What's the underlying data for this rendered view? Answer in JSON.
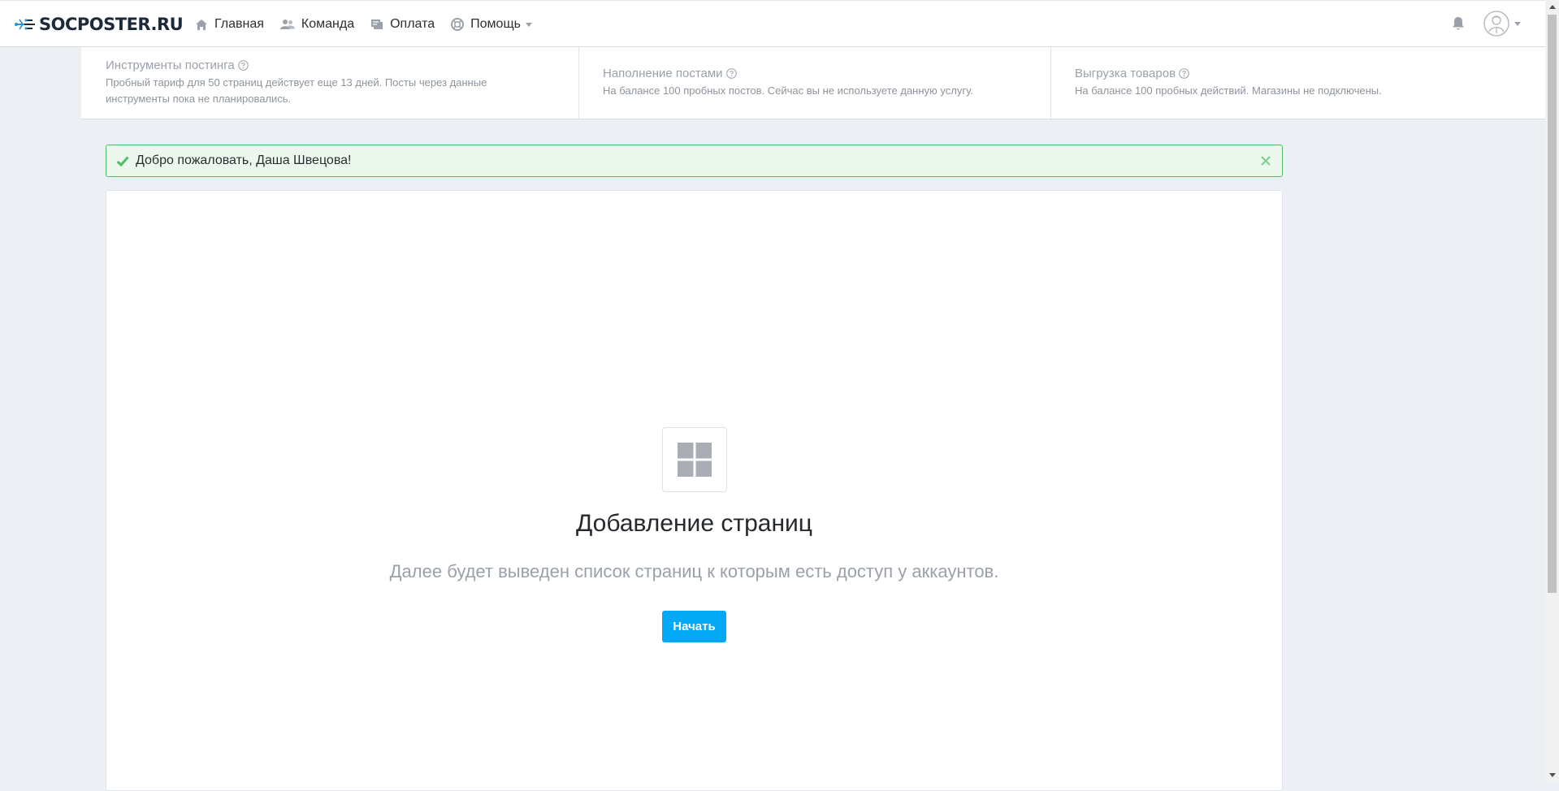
{
  "brand": {
    "name": "SOCPOSTER.RU"
  },
  "nav": {
    "items": [
      {
        "label": "Главная",
        "icon": "home-icon"
      },
      {
        "label": "Команда",
        "icon": "team-icon"
      },
      {
        "label": "Оплата",
        "icon": "payment-icon"
      },
      {
        "label": "Помощь",
        "icon": "help-lifebuoy-icon"
      }
    ]
  },
  "header_right": {
    "bell_icon": "bell-icon",
    "avatar_icon": "user-avatar-icon"
  },
  "info": {
    "posting": {
      "title": "Инструменты постинга",
      "text_line1": "Пробный тариф для 50 страниц действует еще 13 дней. Посты через данные",
      "text_line2": "инструменты пока не планировались."
    },
    "filling": {
      "title": "Наполнение постами",
      "text": "На балансе 100 пробных постов. Сейчас вы не используете данную услугу."
    },
    "export": {
      "title": "Выгрузка товаров",
      "text": "На балансе 100 пробных действий. Магазины не подключены."
    }
  },
  "alert": {
    "text": "Добро пожаловать, Даша Швецова!"
  },
  "card": {
    "title": "Добавление страниц",
    "description": "Далее будет выведен список страниц к которым есть доступ у аккаунтов.",
    "start_label": "Начать"
  },
  "colors": {
    "accent": "#03a9f4",
    "success": "#4dbf61",
    "success_bg": "#ecf8ee",
    "page_bg": "#eceff3"
  }
}
